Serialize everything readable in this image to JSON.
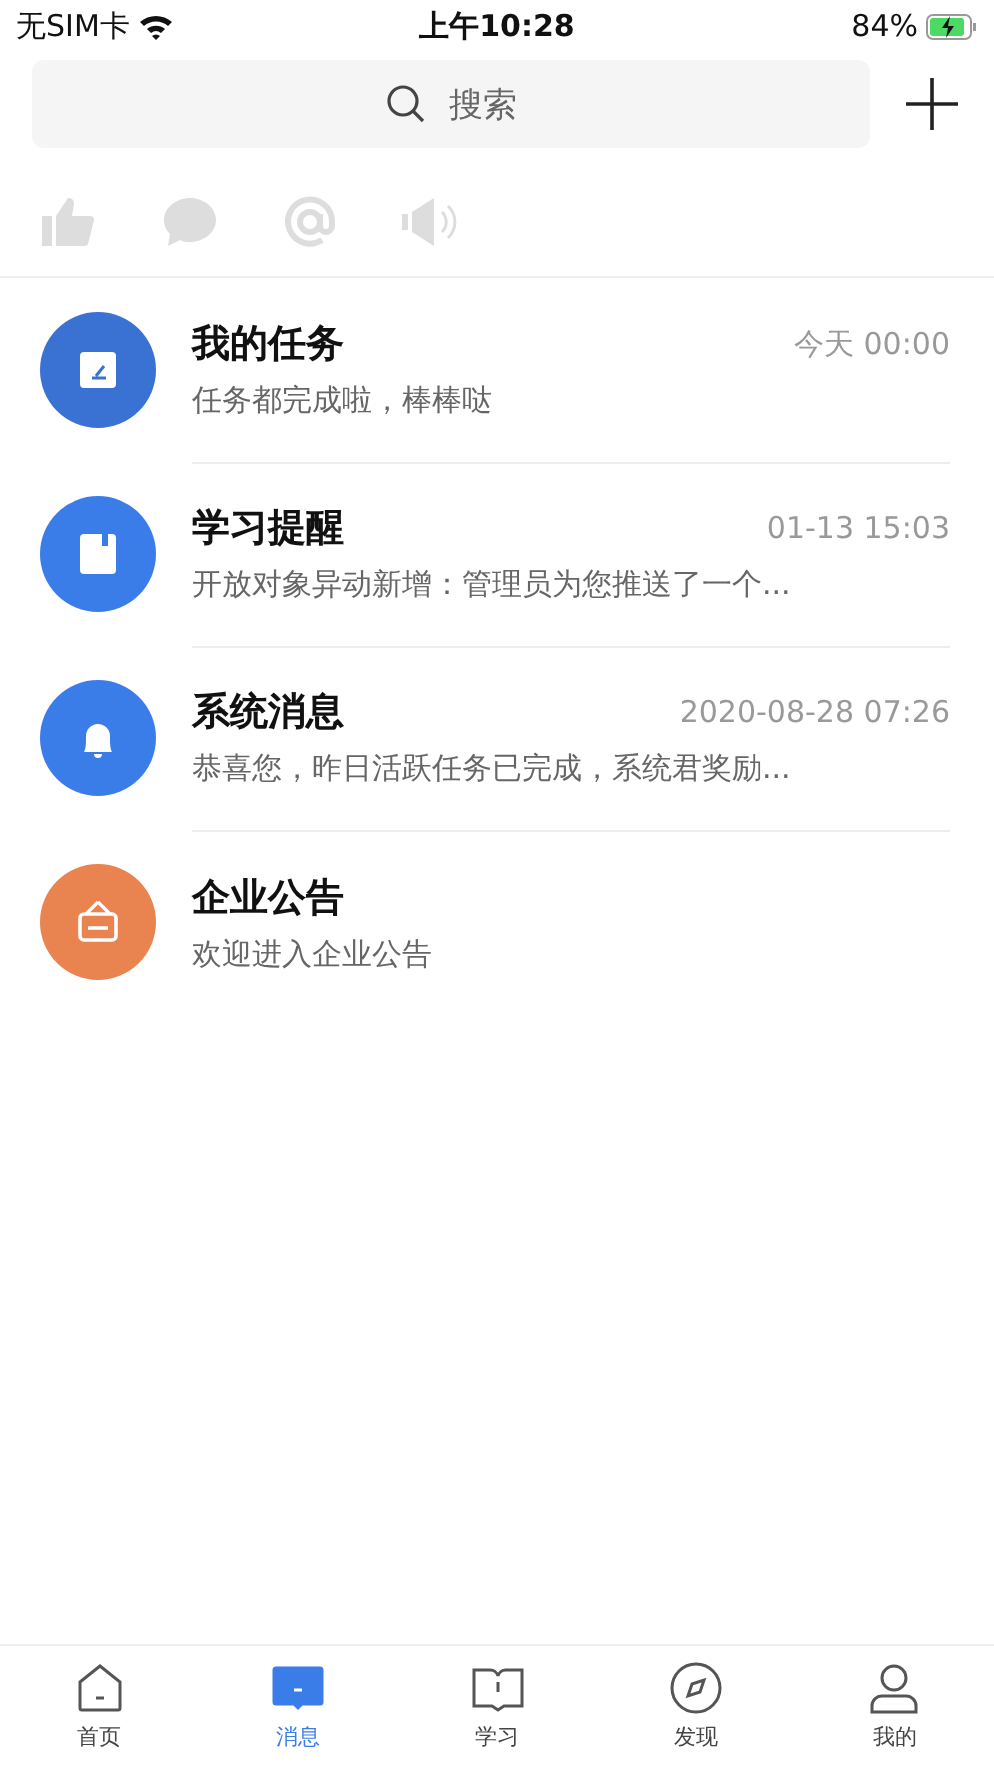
{
  "status_bar": {
    "carrier": "无SIM卡",
    "time": "上午10:28",
    "battery": "84%"
  },
  "search": {
    "placeholder": "搜索"
  },
  "messages": [
    {
      "kind": "task",
      "color": "#3a72d4",
      "title": "我的任务",
      "time": "今天 00:00",
      "preview": "任务都完成啦，棒棒哒"
    },
    {
      "kind": "study",
      "color": "#3b7de8",
      "title": "学习提醒",
      "time": "01-13 15:03",
      "preview": "开放对象异动新增：管理员为您推送了一个..."
    },
    {
      "kind": "system",
      "color": "#3b7de8",
      "title": "系统消息",
      "time": "2020-08-28 07:26",
      "preview": "恭喜您，昨日活跃任务已完成，系统君奖励..."
    },
    {
      "kind": "notice",
      "color": "#e9834f",
      "title": "企业公告",
      "preview": "欢迎进入企业公告"
    }
  ],
  "tabs": [
    {
      "kind": "home",
      "label": "首页",
      "selected": false
    },
    {
      "kind": "message",
      "label": "消息",
      "selected": true
    },
    {
      "kind": "study",
      "label": "学习",
      "selected": false
    },
    {
      "kind": "discover",
      "label": "发现",
      "selected": false
    },
    {
      "kind": "me",
      "label": "我的",
      "selected": false
    }
  ]
}
